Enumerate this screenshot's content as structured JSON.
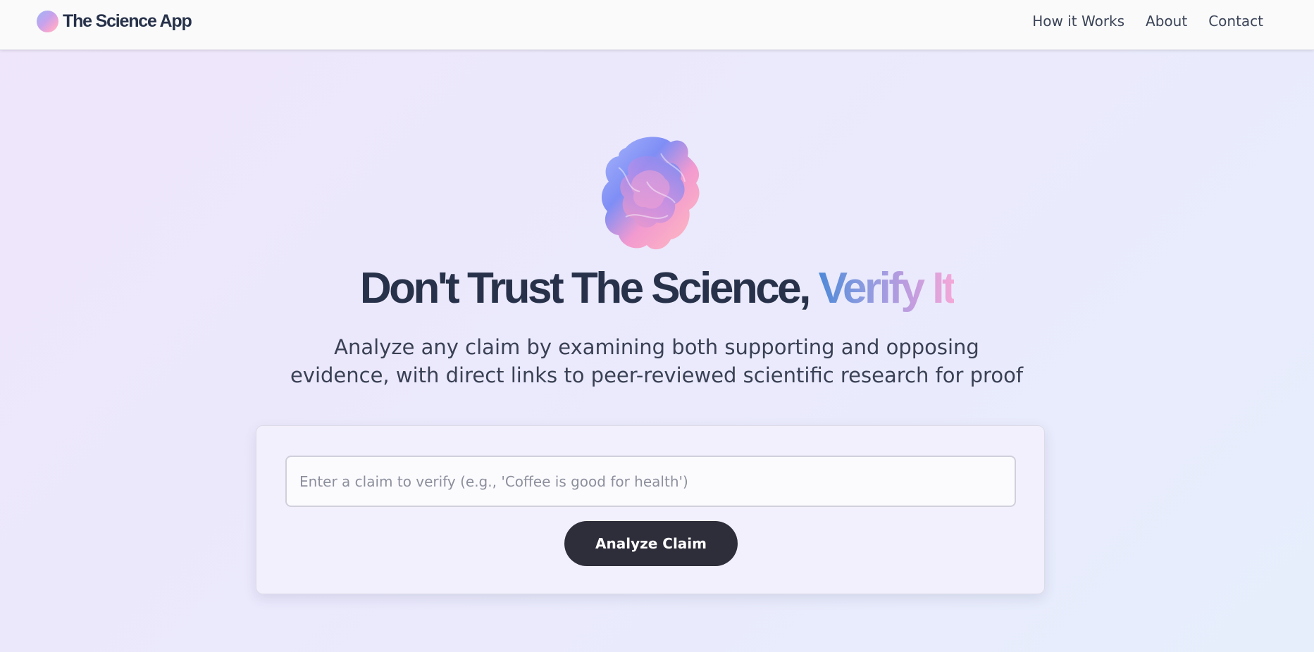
{
  "navbar": {
    "brand_name": "The Science App",
    "links": [
      {
        "label": "How it Works"
      },
      {
        "label": "About"
      },
      {
        "label": "Contact"
      }
    ]
  },
  "hero": {
    "headline_main": "Don't Trust The Science, ",
    "headline_accent": "Verify It",
    "subtitle_line1": "Analyze any claim by examining both supporting and opposing",
    "subtitle_line2": "evidence, with direct links to peer-reviewed scientific research for proof",
    "art_icon": "abstract-gradient-blob-icon"
  },
  "form": {
    "claim_placeholder": "Enter a claim to verify (e.g., 'Coffee is good for health')",
    "claim_value": "",
    "submit_label": "Analyze Claim"
  },
  "colors": {
    "text_primary": "#27324a",
    "button_bg": "#2e2d3a",
    "accent_start": "#4f89d8",
    "accent_end": "#f4a8d8",
    "background_start": "#efe6fb",
    "background_end": "#e6eefc"
  }
}
